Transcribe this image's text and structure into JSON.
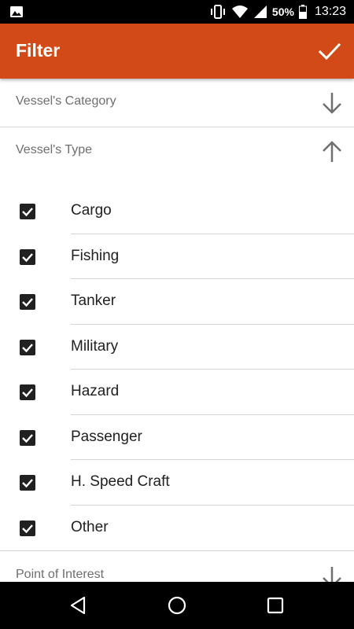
{
  "status_bar": {
    "battery_percent": "50%",
    "time": "13:23",
    "icons": [
      "gallery-icon",
      "vibrate-icon",
      "wifi-icon",
      "signal-icon",
      "battery-icon"
    ]
  },
  "app_bar": {
    "title": "Filter",
    "confirm_icon": "check-icon",
    "background_color": "#d24a17"
  },
  "sections": {
    "vessels_category": {
      "label": "Vessel's Category",
      "icon": "arrow-down-icon",
      "expanded": false
    },
    "vessels_type": {
      "label": "Vessel's Type",
      "icon": "arrow-up-icon",
      "expanded": true
    },
    "point_of_interest": {
      "label": "Point of Interest",
      "icon": "arrow-down-icon",
      "expanded": false
    }
  },
  "vessel_types": [
    {
      "label": "Cargo",
      "checked": true
    },
    {
      "label": "Fishing",
      "checked": true
    },
    {
      "label": "Tanker",
      "checked": true
    },
    {
      "label": "Military",
      "checked": true
    },
    {
      "label": "Hazard",
      "checked": true
    },
    {
      "label": "Passenger",
      "checked": true
    },
    {
      "label": "H. Speed Craft",
      "checked": true
    },
    {
      "label": "Other",
      "checked": true
    }
  ],
  "nav_bar": {
    "buttons": [
      "back-icon",
      "home-icon",
      "recents-icon"
    ]
  }
}
